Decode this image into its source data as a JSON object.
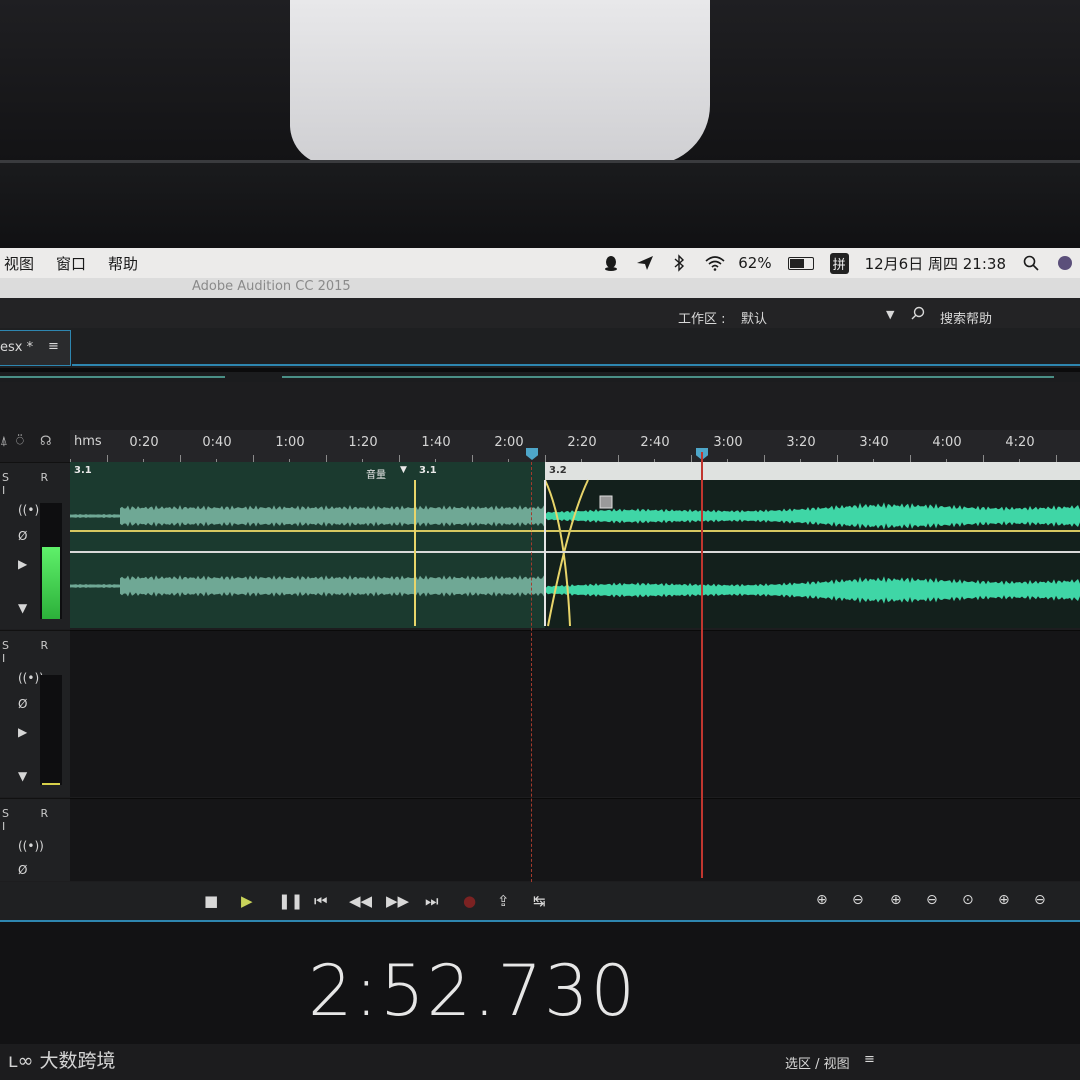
{
  "menubar": {
    "menus": [
      "视图",
      "窗口",
      "帮助"
    ],
    "battery_pct": "62%",
    "ime": "拼",
    "datetime": "12月6日 周四 21:38",
    "icons": [
      "qq-icon",
      "feishu-icon",
      "bluetooth-icon",
      "wifi-icon",
      "battery-icon",
      "search-icon",
      "siri-icon"
    ]
  },
  "app": {
    "title": "Adobe Audition CC 2015"
  },
  "workspace": {
    "label": "工作区 :",
    "value": "默认",
    "search_label": "搜索帮助"
  },
  "tab": {
    "name": "esx *",
    "menu": "≡"
  },
  "ruler": {
    "unit": "hms",
    "labels": [
      "0:20",
      "0:40",
      "1:00",
      "1:20",
      "1:40",
      "2:00",
      "2:20",
      "2:40",
      "3:00",
      "3:20",
      "3:40",
      "4:00",
      "4:20"
    ]
  },
  "tracks": [
    {
      "r": "R",
      "i": "I"
    },
    {
      "r": "R",
      "i": "I"
    },
    {
      "r": "R",
      "i": "I"
    }
  ],
  "clips": {
    "clip1_label": "3.1",
    "clip1b_label": "3.1",
    "clip2_label": "3.2",
    "volume_label": "音量"
  },
  "playhead_time_s": 172.73,
  "transport": {
    "buttons": [
      "stop",
      "play",
      "pause",
      "to-start",
      "rewind",
      "fast-forward",
      "to-end",
      "record",
      "skip-selection",
      "loop"
    ]
  },
  "time_display": {
    "value": "2:52.730"
  },
  "footer": {
    "selection_view": "选区 / 视图",
    "menu": "≡"
  },
  "watermark": {
    "text": "大数跨境"
  },
  "colors": {
    "accent": "#2e86b0",
    "waveform": "#3fd6a6",
    "playhead": "#c0362f",
    "fade": "#e8d56a"
  }
}
